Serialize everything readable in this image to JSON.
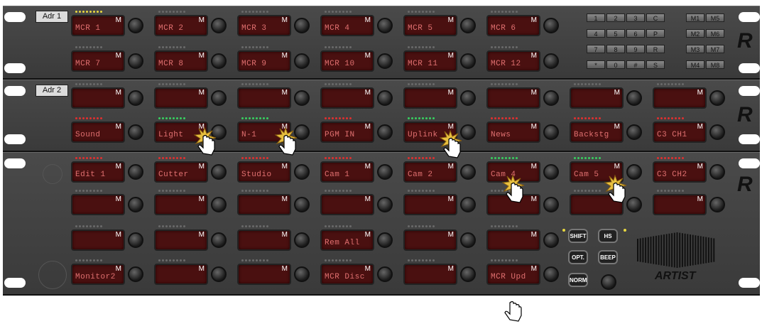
{
  "panels": [
    {
      "address": "Adr 1"
    },
    {
      "address": "Adr 2"
    },
    {
      "address": ""
    }
  ],
  "row1a": [
    {
      "label": "MCR 1",
      "m": "M",
      "leds": "yellow"
    },
    {
      "label": "MCR 2",
      "m": "M",
      "leds": "off"
    },
    {
      "label": "MCR 3",
      "m": "M",
      "leds": "off"
    },
    {
      "label": "MCR 4",
      "m": "M",
      "leds": "off"
    },
    {
      "label": "MCR 5",
      "m": "M",
      "leds": "off"
    },
    {
      "label": "MCR 6",
      "m": "M",
      "leds": "off"
    }
  ],
  "row1b": [
    {
      "label": "MCR 7",
      "m": "M",
      "leds": "off"
    },
    {
      "label": "MCR 8",
      "m": "M",
      "leds": "off"
    },
    {
      "label": "MCR 9",
      "m": "M",
      "leds": "off"
    },
    {
      "label": "MCR 10",
      "m": "M",
      "leds": "off"
    },
    {
      "label": "MCR 11",
      "m": "M",
      "leds": "off"
    },
    {
      "label": "MCR 12",
      "m": "M",
      "leds": "off"
    }
  ],
  "keypad": {
    "keys": [
      "1",
      "2",
      "3",
      "C",
      "4",
      "5",
      "6",
      "P",
      "7",
      "8",
      "9",
      "R",
      "*",
      "0",
      "#",
      "S"
    ],
    "mem": [
      "M1",
      "M5",
      "M2",
      "M6",
      "M3",
      "M7",
      "M4",
      "M8"
    ]
  },
  "row2a": [
    {
      "label": "",
      "m": "M",
      "leds": "off"
    },
    {
      "label": "",
      "m": "M",
      "leds": "off"
    },
    {
      "label": "",
      "m": "M",
      "leds": "off"
    },
    {
      "label": "",
      "m": "M",
      "leds": "off"
    },
    {
      "label": "",
      "m": "M",
      "leds": "off"
    },
    {
      "label": "",
      "m": "M",
      "leds": "off"
    },
    {
      "label": "",
      "m": "M",
      "leds": "off"
    },
    {
      "label": "",
      "m": "M",
      "leds": "off"
    }
  ],
  "row2b": [
    {
      "label": "Sound",
      "m": "M",
      "leds": "red"
    },
    {
      "label": "Light",
      "m": "M",
      "leds": "green"
    },
    {
      "label": "N-1",
      "m": "M",
      "leds": "green"
    },
    {
      "label": "PGM IN",
      "m": "M",
      "leds": "red"
    },
    {
      "label": "Uplink",
      "m": "M",
      "leds": "green"
    },
    {
      "label": "News",
      "m": "M",
      "leds": "red"
    },
    {
      "label": "Backstg",
      "m": "M",
      "leds": "red"
    },
    {
      "label": "C3  CH1",
      "m": "M",
      "leds": "red"
    }
  ],
  "row3a": [
    {
      "label": "Edit 1",
      "m": "M",
      "leds": "red"
    },
    {
      "label": "Cutter",
      "m": "M",
      "leds": "red"
    },
    {
      "label": "Studio",
      "m": "M",
      "leds": "red"
    },
    {
      "label": "Cam 1",
      "m": "M",
      "leds": "red"
    },
    {
      "label": "Cam 2",
      "m": "M",
      "leds": "red"
    },
    {
      "label": "Cam 4",
      "m": "M",
      "leds": "green"
    },
    {
      "label": "Cam 5",
      "m": "M",
      "leds": "green"
    },
    {
      "label": "C3  CH2",
      "m": "M",
      "leds": "red"
    }
  ],
  "row3b": [
    {
      "label": "",
      "m": "M",
      "leds": "off"
    },
    {
      "label": "",
      "m": "M",
      "leds": "off"
    },
    {
      "label": "",
      "m": "M",
      "leds": "off"
    },
    {
      "label": "",
      "m": "M",
      "leds": "off"
    },
    {
      "label": "",
      "m": "M",
      "leds": "off"
    },
    {
      "label": "",
      "m": "M",
      "leds": "off"
    },
    {
      "label": "",
      "m": "M",
      "leds": "off"
    },
    {
      "label": "",
      "m": "M",
      "leds": "off"
    }
  ],
  "row3c": [
    {
      "label": "",
      "m": "M",
      "leds": "off"
    },
    {
      "label": "",
      "m": "M",
      "leds": "off"
    },
    {
      "label": "",
      "m": "M",
      "leds": "off"
    },
    {
      "label": "Rem All",
      "m": "M",
      "leds": "off"
    },
    {
      "label": "",
      "m": "M",
      "leds": "off"
    },
    {
      "label": "",
      "m": "M",
      "leds": "off"
    }
  ],
  "row3d": [
    {
      "label": "Monitor2",
      "m": "M",
      "leds": "off"
    },
    {
      "label": "",
      "m": "M",
      "leds": "off"
    },
    {
      "label": "",
      "m": "M",
      "leds": "off"
    },
    {
      "label": "MCR Disc",
      "m": "M",
      "leds": "off"
    },
    {
      "label": "",
      "m": "M",
      "leds": "off"
    },
    {
      "label": "MCR Upd",
      "m": "M",
      "leds": "off"
    }
  ],
  "controls": {
    "shift": "SHIFT",
    "hs": "HS",
    "opt": "OPT.",
    "beep": "BEEP",
    "norm": "NORM"
  },
  "brand": {
    "logo_mark": "R",
    "artist": "ARTIST"
  },
  "colors": {
    "panel": "#404040",
    "display": "#4a1010",
    "display_text": "#e07070",
    "led_red": "#e03030",
    "led_green": "#38d060",
    "led_yellow": "#e8d840"
  }
}
